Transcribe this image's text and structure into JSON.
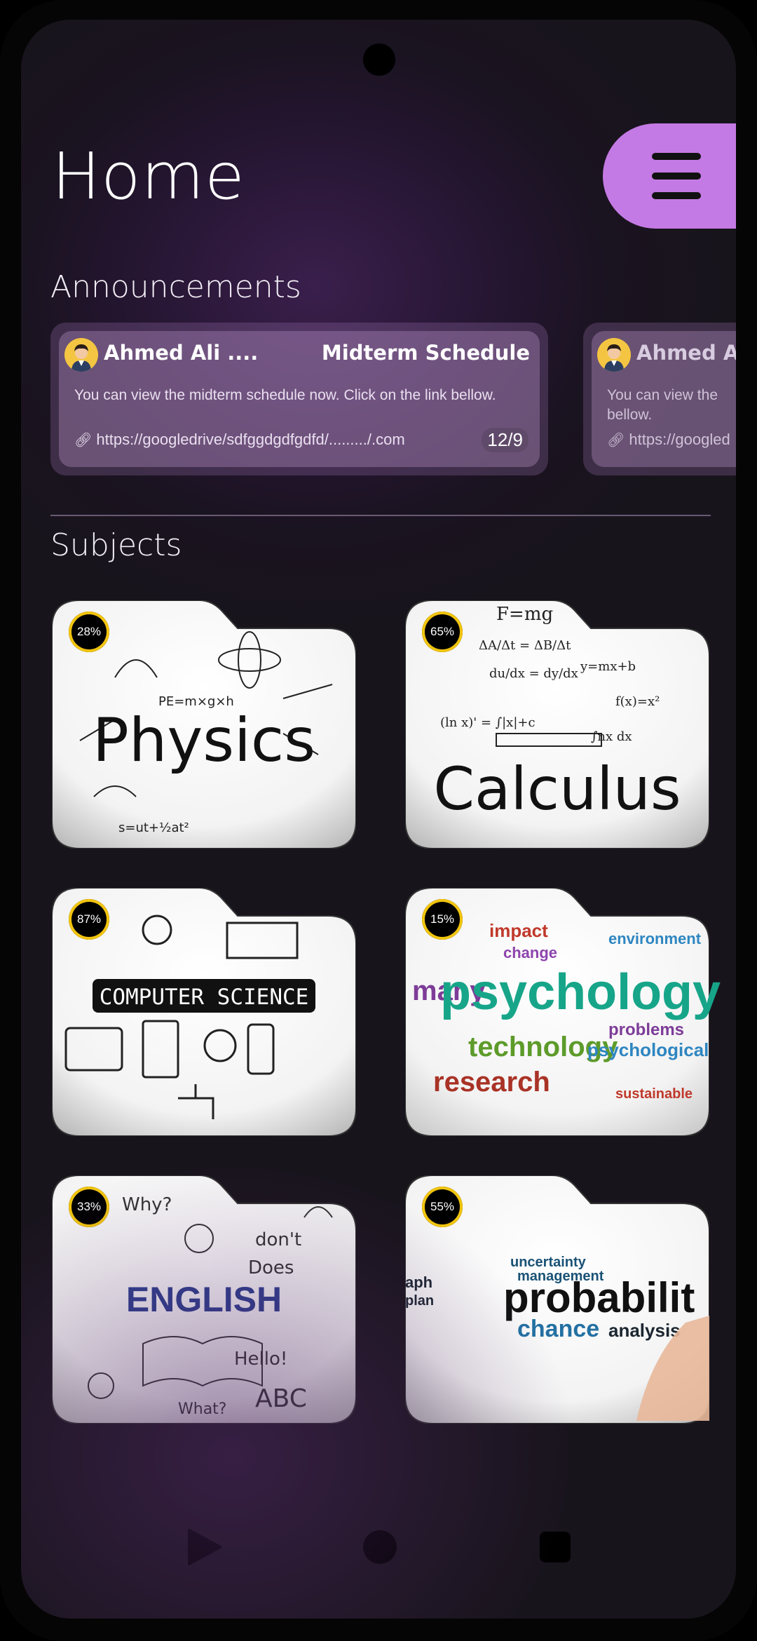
{
  "header": {
    "title": "Home"
  },
  "sections": {
    "announcements": "Announcements",
    "subjects": "Subjects"
  },
  "announcements": [
    {
      "author": "Ahmed Ali ....",
      "title": "Midterm Schedule",
      "body": "You can view the midterm schedule now. Click on the link bellow.",
      "link": "https://googledrive/sdfggdgdfgdfd/........./.com",
      "date": "12/9"
    },
    {
      "author": "Ahmed Al",
      "title": "",
      "body": "You can view the bellow.",
      "link": "https://googled",
      "date": ""
    }
  ],
  "subjects": [
    {
      "name": "Physics",
      "progress": "28%"
    },
    {
      "name": "Calculus",
      "progress": "65%"
    },
    {
      "name": "COMPUTER SCIENCE",
      "progress": "87%"
    },
    {
      "name": "psychology",
      "progress": "15%"
    },
    {
      "name": "ENGLISH",
      "progress": "33%"
    },
    {
      "name": "probabilit",
      "progress": "55%"
    }
  ],
  "icons": {
    "menu": "hamburger-icon",
    "link": "link-icon",
    "avatar": "user-avatar",
    "nav_back": "back-triangle-icon",
    "nav_home": "home-circle-icon",
    "nav_recent": "recent-square-icon"
  },
  "colors": {
    "accent": "#c47ae4",
    "progress_ring": "#f1c40f"
  }
}
